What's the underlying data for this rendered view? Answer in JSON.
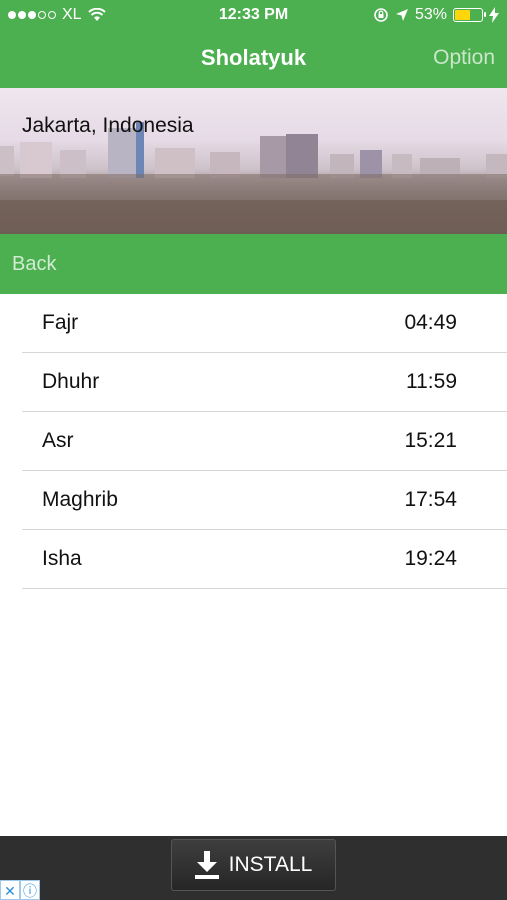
{
  "status_bar": {
    "carrier": "XL",
    "time": "12:33 PM",
    "battery_percent_label": "53%",
    "battery_level": 0.53,
    "icons": [
      "signal-dots",
      "wifi-icon",
      "rotation-lock-icon",
      "location-arrow-icon",
      "battery-icon",
      "charging-bolt-icon"
    ]
  },
  "nav": {
    "title": "Sholatyuk",
    "option_label": "Option"
  },
  "banner": {
    "location": "Jakarta, Indonesia"
  },
  "back_bar": {
    "back_label": "Back"
  },
  "prayers": [
    {
      "name": "Fajr",
      "time": "04:49"
    },
    {
      "name": "Dhuhr",
      "time": "11:59"
    },
    {
      "name": "Asr",
      "time": "15:21"
    },
    {
      "name": "Maghrib",
      "time": "17:54"
    },
    {
      "name": "Isha",
      "time": "19:24"
    }
  ],
  "ad": {
    "install_label": "INSTALL",
    "icons": [
      "close-icon",
      "info-icon",
      "download-icon"
    ]
  },
  "colors": {
    "primary_green": "#4caf50",
    "battery_yellow": "#ffd60a",
    "ad_background": "#2f2f2f"
  }
}
